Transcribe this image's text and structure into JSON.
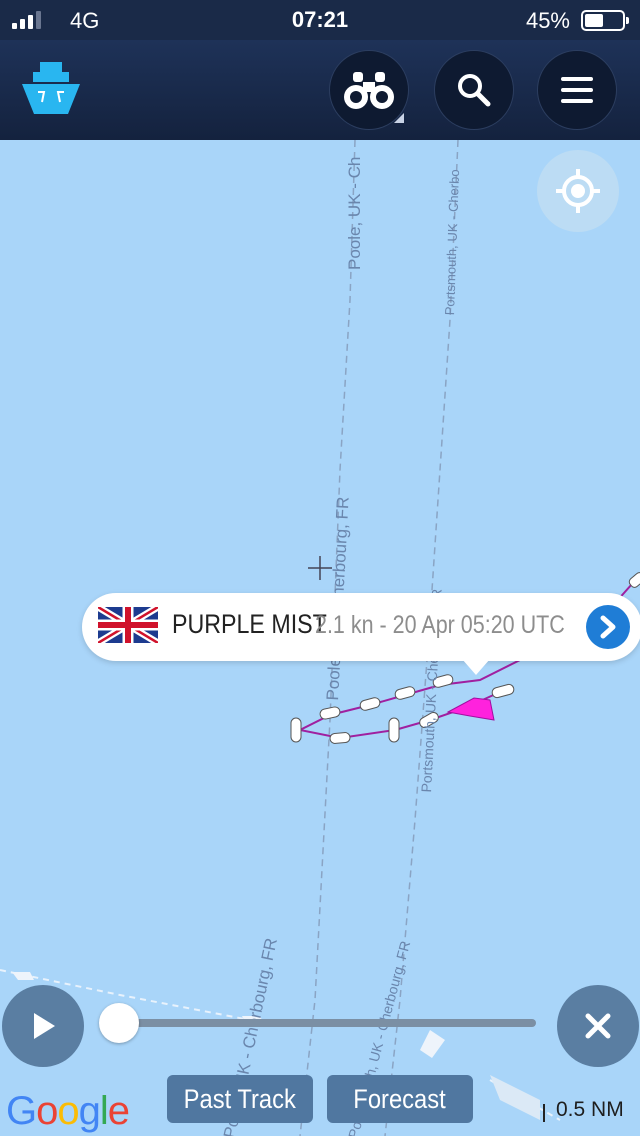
{
  "status_bar": {
    "network": "4G",
    "time": "07:21",
    "battery": "45%"
  },
  "app_bar": {
    "logo_icon": "ship-icon",
    "buttons": [
      {
        "name": "binoculars-button",
        "icon": "binoculars-icon"
      },
      {
        "name": "search-button",
        "icon": "search-icon"
      },
      {
        "name": "menu-button",
        "icon": "hamburger-menu-icon"
      }
    ]
  },
  "map": {
    "route_labels": {
      "poole_top": "Poole, UK - Ch",
      "portsmouth_top": "Portsmouth, UK - Cherbo",
      "poole_mid": "Poole, UK - Cherbourg, FR",
      "portsmouth_mid": "Portsmouth, UK - Cherbourg, FR",
      "poole_bottom": "Poole, UK - Cherbourg, FR",
      "portsmouth_bottom": "Portsmouth, UK - Cherbourg, FR"
    },
    "track_color": "#a020a0",
    "vessel_color": "#ff22dd",
    "water_color": "#a9d5f9"
  },
  "popup": {
    "flag": "United Kingdom",
    "name": "PURPLE MIST",
    "info": "2.1 kn - 20 Apr 05:20 UTC"
  },
  "playback": {
    "play_icon": "play-icon",
    "close_icon": "close-icon",
    "progress": 0.0
  },
  "footer": {
    "google": [
      "G",
      "o",
      "o",
      "g",
      "l",
      "e"
    ],
    "past_track": "Past Track",
    "forecast": "Forecast",
    "scale": "0.5 NM"
  }
}
